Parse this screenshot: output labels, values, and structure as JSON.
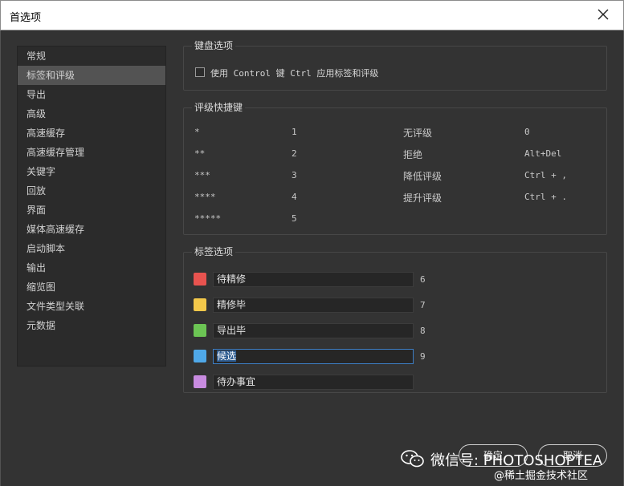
{
  "window": {
    "title": "首选项"
  },
  "sidebar": {
    "items": [
      {
        "label": "常规"
      },
      {
        "label": "标签和评级"
      },
      {
        "label": "导出"
      },
      {
        "label": "高级"
      },
      {
        "label": "高速缓存"
      },
      {
        "label": "高速缓存管理"
      },
      {
        "label": "关键字"
      },
      {
        "label": "回放"
      },
      {
        "label": "界面"
      },
      {
        "label": "媒体高速缓存"
      },
      {
        "label": "启动脚本"
      },
      {
        "label": "输出"
      },
      {
        "label": "缩览图"
      },
      {
        "label": "文件类型关联"
      },
      {
        "label": "元数据"
      }
    ],
    "selected": "标签和评级"
  },
  "keyboard_group": {
    "title": "键盘选项",
    "option_label": "使用 Control 键 Ctrl 应用标签和评级",
    "checked": false
  },
  "rating_group": {
    "title": "评级快捷键",
    "rows": [
      {
        "stars": "*",
        "key": "1",
        "action": "无评级",
        "shortcut": "0"
      },
      {
        "stars": "**",
        "key": "2",
        "action": "拒绝",
        "shortcut": "Alt+Del"
      },
      {
        "stars": "***",
        "key": "3",
        "action": "降低评级",
        "shortcut": "Ctrl + ,"
      },
      {
        "stars": "****",
        "key": "4",
        "action": "提升评级",
        "shortcut": "Ctrl + ."
      },
      {
        "stars": "*****",
        "key": "5",
        "action": "",
        "shortcut": ""
      }
    ]
  },
  "label_group": {
    "title": "标签选项",
    "labels": [
      {
        "name": "待精修",
        "key": "6",
        "color": "#e8534f"
      },
      {
        "name": "精修毕",
        "key": "7",
        "color": "#f3c84a"
      },
      {
        "name": "导出毕",
        "key": "8",
        "color": "#6cc554"
      },
      {
        "name": "候选",
        "key": "9",
        "color": "#4fa8e8"
      },
      {
        "name": "待办事宜",
        "key": "",
        "color": "#c88be0"
      }
    ]
  },
  "buttons": {
    "ok": "确定",
    "cancel": "取消"
  },
  "watermark": {
    "line1": "微信号: PHOTOSHOPTEA",
    "line2": "@稀土掘金技术社区"
  }
}
